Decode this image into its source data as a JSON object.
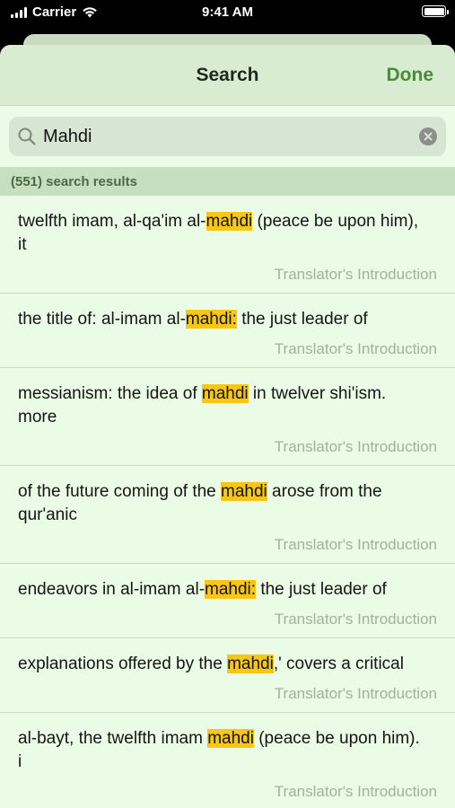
{
  "status_bar": {
    "carrier": "Carrier",
    "time": "9:41 AM"
  },
  "nav": {
    "title": "Search",
    "done_label": "Done"
  },
  "search": {
    "value": "Mahdi",
    "placeholder": "Search"
  },
  "results_header": "(551) search results",
  "results": [
    {
      "before": "twelfth imam, al-qa'im al-",
      "highlight": "mahdi",
      "after": " (peace be upon him), it",
      "source": "Translator's Introduction"
    },
    {
      "before": "the title of: al-imam al-",
      "highlight": "mahdi:",
      "after": " the just leader of",
      "source": "Translator's Introduction"
    },
    {
      "before": "messianism: the idea of ",
      "highlight": "mahdi",
      "after": " in twelver shi'ism. more",
      "source": "Translator's Introduction"
    },
    {
      "before": "of the future coming of the ",
      "highlight": "mahdi",
      "after": " arose from the qur'anic",
      "source": "Translator's Introduction"
    },
    {
      "before": "endeavors in al-imam al-",
      "highlight": "mahdi:",
      "after": " the just leader of",
      "source": "Translator's Introduction"
    },
    {
      "before": "explanations offered by the ",
      "highlight": "mahdi",
      "after": ",' covers a critical",
      "source": "Translator's Introduction"
    },
    {
      "before": "al-bayt, the twelfth imam ",
      "highlight": "mahdi",
      "after": " (peace be upon him). i",
      "source": "Translator's Introduction"
    }
  ],
  "colors": {
    "highlight": "#f8c615",
    "accent": "#4b8a3a",
    "background": "#eafbe6"
  }
}
